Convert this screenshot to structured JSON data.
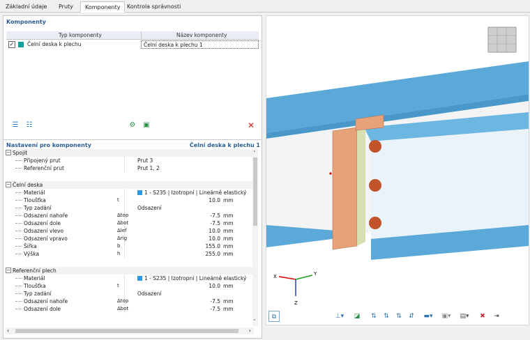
{
  "tabs": [
    {
      "label": "Základní údaje"
    },
    {
      "label": "Pruty"
    },
    {
      "label": "Komponenty"
    },
    {
      "label": "Kontrola správnosti"
    }
  ],
  "components": {
    "title": "Komponenty",
    "col_type": "Typ komponenty",
    "col_name": "Název komponenty",
    "rows": [
      {
        "checked": true,
        "type": "Čelní deska k plechu",
        "name": "Čelní deska k plechu 1",
        "color": "#13a09a"
      }
    ]
  },
  "settings": {
    "title": "Nastavení pro komponenty",
    "selected": "Čelní deska k plechu 1",
    "groups": [
      {
        "label": "Spojit",
        "rows": [
          {
            "label": "Připojený prut",
            "sym": "",
            "text": "Prut 3",
            "num": "",
            "unit": ""
          },
          {
            "label": "Referenční prut",
            "sym": "",
            "text": "Prut 1, 2",
            "num": "",
            "unit": ""
          }
        ]
      },
      {
        "label": "Čelní deska",
        "rows": [
          {
            "label": "Materiál",
            "sym": "",
            "text": "1 - S235 | Izotropní | Lineárně elastický",
            "num": "",
            "unit": "",
            "mat": true
          },
          {
            "label": "Tloušťka",
            "sym": "t",
            "text": "",
            "num": "10.0",
            "unit": "mm"
          },
          {
            "label": "Typ zadání",
            "sym": "",
            "text": "Odsazení",
            "num": "",
            "unit": ""
          },
          {
            "label": "Odsazení nahoře",
            "sym": "Δtop",
            "text": "",
            "num": "-7.5",
            "unit": "mm"
          },
          {
            "label": "Odsazení dole",
            "sym": "Δbot",
            "text": "",
            "num": "-7.5",
            "unit": "mm"
          },
          {
            "label": "Odsazení vlevo",
            "sym": "Δlef",
            "text": "",
            "num": "10.0",
            "unit": "mm"
          },
          {
            "label": "Odsazení vpravo",
            "sym": "Δrig",
            "text": "",
            "num": "10.0",
            "unit": "mm"
          },
          {
            "label": "Šířka",
            "sym": "b",
            "text": "",
            "num": "155.0",
            "unit": "mm"
          },
          {
            "label": "Výška",
            "sym": "h",
            "text": "",
            "num": "255.0",
            "unit": "mm"
          }
        ]
      },
      {
        "label": "Referenční plech",
        "rows": [
          {
            "label": "Materiál",
            "sym": "",
            "text": "1 - S235 | Izotropní | Lineárně elastický",
            "num": "",
            "unit": "",
            "mat": true
          },
          {
            "label": "Tloušťka",
            "sym": "t",
            "text": "",
            "num": "10.0",
            "unit": "mm"
          },
          {
            "label": "Typ zadání",
            "sym": "",
            "text": "Odsazení",
            "num": "",
            "unit": ""
          },
          {
            "label": "Odsazení nahoře",
            "sym": "Δtop",
            "text": "",
            "num": "-7.5",
            "unit": "mm"
          },
          {
            "label": "Odsazení dole",
            "sym": "Δbot",
            "text": "",
            "num": "-7.5",
            "unit": "mm"
          }
        ]
      }
    ]
  },
  "viewport": {
    "axes": {
      "x": "X",
      "y": "Y",
      "z": "Z"
    }
  },
  "colors": {
    "accent": "#2b5d93",
    "steel": "#5aa9d9",
    "plate": "#e8a27a",
    "bolt": "#c0532a"
  }
}
